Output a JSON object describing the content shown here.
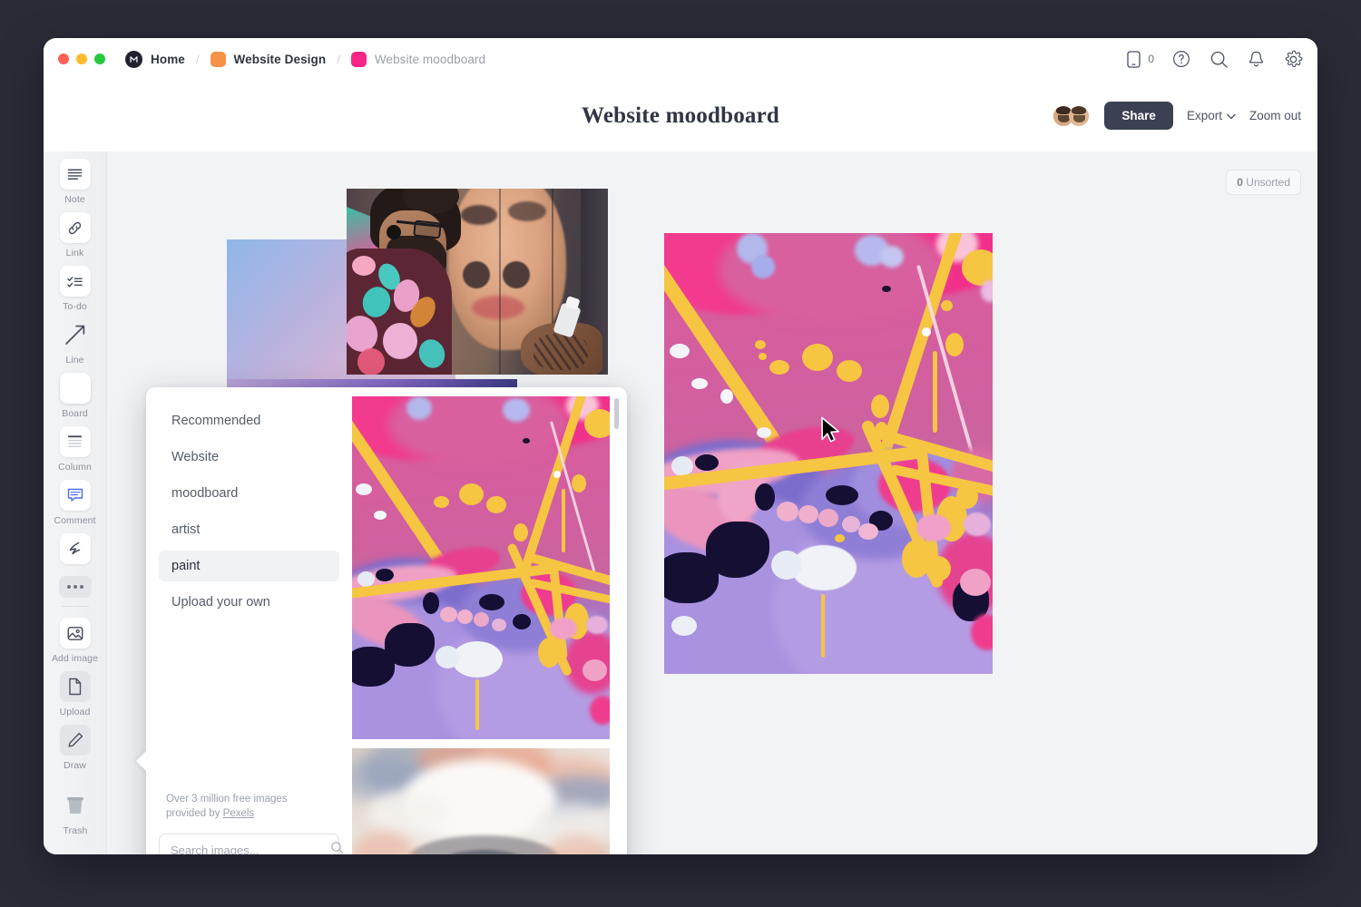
{
  "window": {
    "traffic_lights": [
      "close",
      "minimize",
      "maximize"
    ]
  },
  "breadcrumb": {
    "items": [
      {
        "label": "Home",
        "icon": "milanote-logo-icon",
        "swatch": "#22222e",
        "muted": false
      },
      {
        "label": "Website Design",
        "icon": "folder-swatch-icon",
        "swatch": "#f59248",
        "muted": false
      },
      {
        "label": "Website moodboard",
        "icon": "board-swatch-icon",
        "swatch": "#f72585",
        "muted": true
      }
    ],
    "separator": "/"
  },
  "titlebar_right": {
    "mobile_count": "0",
    "icons": [
      "mobile-icon",
      "help-icon",
      "search-icon",
      "notifications-icon",
      "settings-icon"
    ]
  },
  "header": {
    "title": "Website moodboard",
    "share_label": "Share",
    "export_label": "Export",
    "zoom_out_label": "Zoom out",
    "avatars": [
      {
        "name": "collaborator-1",
        "skin": "#d8a882",
        "hair": "#3b2a22"
      },
      {
        "name": "collaborator-2",
        "skin": "#e0b894",
        "hair": "#4a3528"
      }
    ]
  },
  "sidebar": {
    "items": [
      {
        "label": "Note",
        "icon": "note-icon",
        "style": "white"
      },
      {
        "label": "Link",
        "icon": "link-icon",
        "style": "white"
      },
      {
        "label": "To-do",
        "icon": "todo-icon",
        "style": "white"
      },
      {
        "label": "Line",
        "icon": "line-arrow-icon",
        "style": "flat"
      },
      {
        "label": "Board",
        "icon": "board-icon",
        "style": "accent"
      },
      {
        "label": "Column",
        "icon": "column-icon",
        "style": "white"
      },
      {
        "label": "Comment",
        "icon": "comment-icon",
        "style": "white"
      },
      {
        "label": "",
        "icon": "more-dots-icon",
        "style": "grey"
      },
      {
        "label": "Add image",
        "icon": "add-image-icon",
        "style": "white"
      },
      {
        "label": "Upload",
        "icon": "upload-file-icon",
        "style": "grey"
      },
      {
        "label": "Draw",
        "icon": "draw-pencil-icon",
        "style": "grey"
      }
    ],
    "trash": {
      "label": "Trash",
      "icon": "trash-icon"
    },
    "accent_color": "#5a7af0"
  },
  "canvas": {
    "unsorted_count": "0",
    "unsorted_label": "Unsorted",
    "items": [
      {
        "name": "gradient-card",
        "kind": "gradient"
      },
      {
        "name": "graffiti-artist-photo",
        "kind": "photo"
      },
      {
        "name": "paint-pour-artwork",
        "kind": "photo"
      }
    ]
  },
  "image_popup": {
    "categories": [
      {
        "label": "Recommended",
        "active": false
      },
      {
        "label": "Website",
        "active": false
      },
      {
        "label": "moodboard",
        "active": false
      },
      {
        "label": "artist",
        "active": false
      },
      {
        "label": "paint",
        "active": true
      },
      {
        "label": "Upload your own",
        "active": false
      }
    ],
    "footer_note_line1": "Over 3 million free images",
    "footer_note_line2_prefix": "provided by ",
    "footer_note_link": "Pexels",
    "search_placeholder": "Search images...",
    "search_value": "",
    "results": [
      {
        "name": "paint-pour-result",
        "alt": "pink and yellow paint pour"
      },
      {
        "name": "eye-painting-result",
        "alt": "painted eye in pastel blue and peach"
      }
    ]
  },
  "colors": {
    "accent": "#5a7af0",
    "share_button": "#3b4152",
    "desktop_bg": "#2b2b38",
    "canvas_bg": "#f2f3f5",
    "paint_pink": "#d45aa0",
    "paint_yellow": "#f6c542",
    "paint_purple": "#9b86e0",
    "paint_magenta": "#f0408f",
    "paint_navy": "#140f33"
  }
}
